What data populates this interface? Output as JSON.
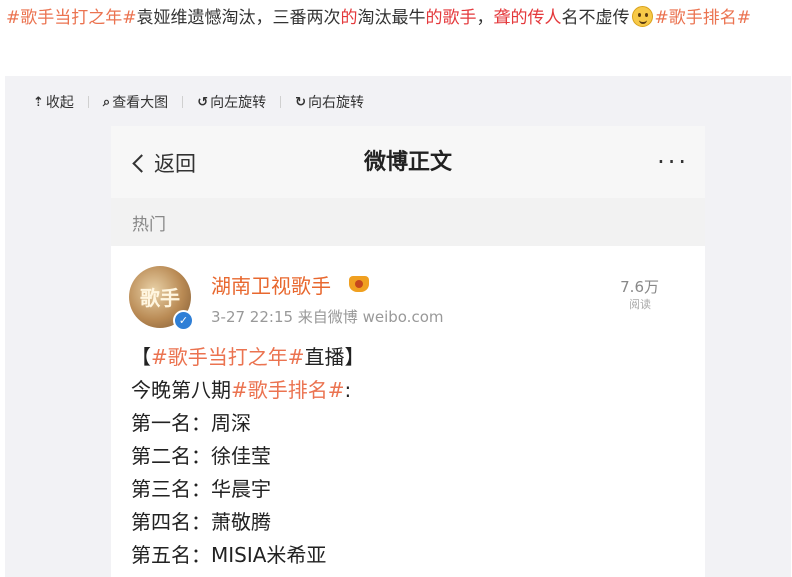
{
  "post": {
    "tag1": "#歌手当打之年#",
    "text1": "袁娅维遗憾淘汰，三番两次",
    "hl1": "的",
    "text2": "淘汰最牛",
    "hl2": "的歌手",
    "text3": "，",
    "hl3": "聋的传人",
    "text4": "名不虚传",
    "emoji_icon": "grin-emoji-icon",
    "tag2": "#歌手排名#"
  },
  "toolbar": {
    "collapse": "收起",
    "view_large": "查看大图",
    "rotate_left": "向左旋转",
    "rotate_right": "向右旋转"
  },
  "phone": {
    "back_label": "返回",
    "title": "微博正文",
    "more": "···",
    "section": "热门",
    "user": {
      "name": "湖南卫视歌手",
      "avatar_text": "歌手",
      "meta": "3-27 22:15  来自微博 weibo.com",
      "reads": "7.6万",
      "reads_label": "阅读"
    },
    "content": {
      "l1_a": "【",
      "l1_tag": "#歌手当打之年#",
      "l1_b": "直播】",
      "l2_a": "今晚第八期",
      "l2_tag": "#歌手排名#",
      "l2_b": ":",
      "ranks": [
        "第一名：周深",
        "第二名：徐佳莹",
        "第三名：华晨宇",
        "第四名：萧敬腾",
        "第五名：MISIA米希亚"
      ]
    }
  },
  "colors": {
    "tag": "#eb7350",
    "highlight": "#e4393c",
    "viewer_bg": "#f2f2f5",
    "verify_blue": "#2f7fd6"
  }
}
